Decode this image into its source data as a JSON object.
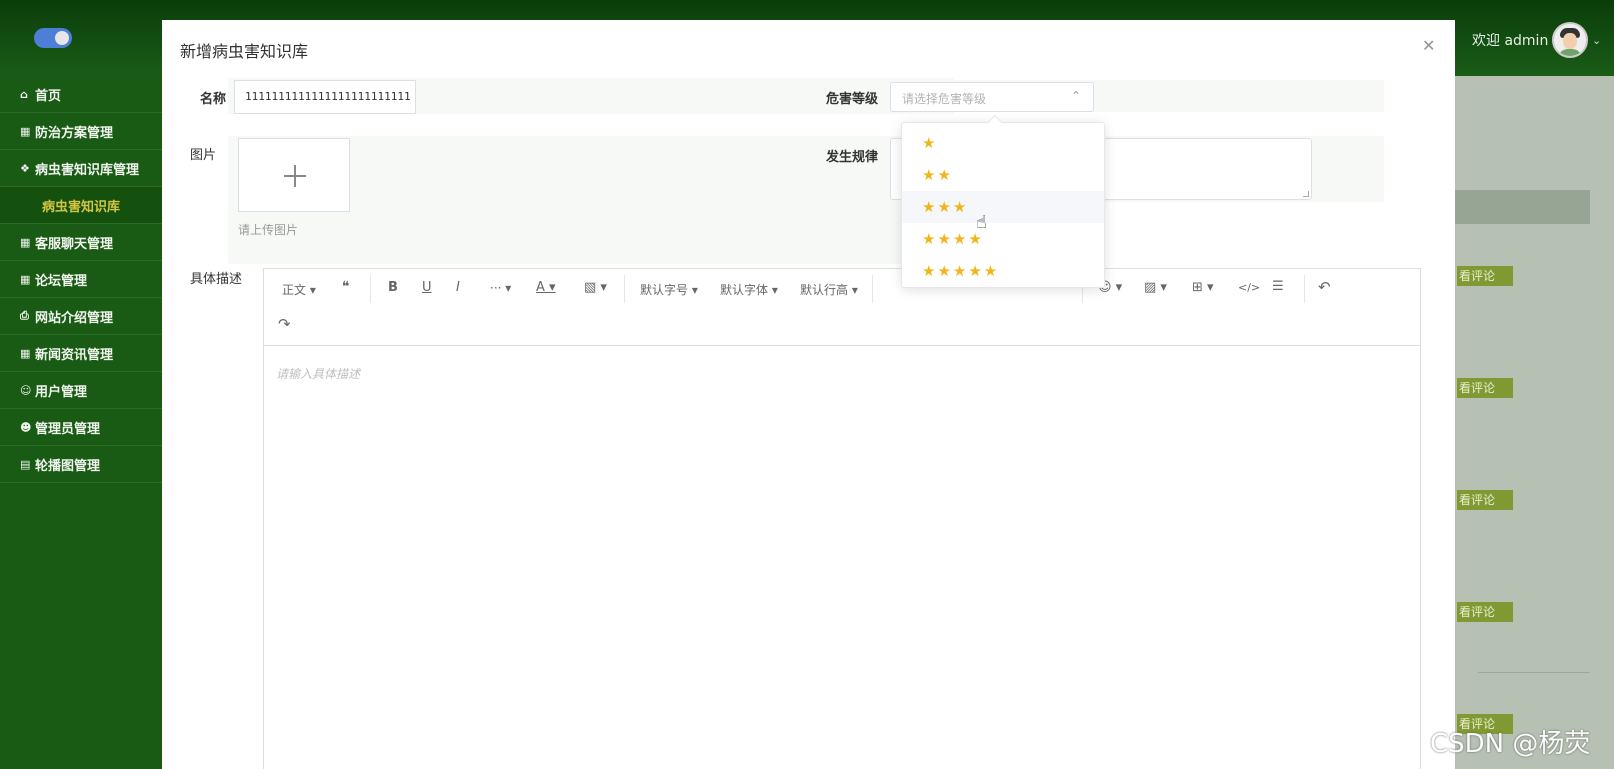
{
  "header": {
    "welcome": "欢迎 admin"
  },
  "sidebar": {
    "items": [
      {
        "icon": "home-icon",
        "glyph": "⌂",
        "label": "首页"
      },
      {
        "icon": "list-icon",
        "glyph": "▦",
        "label": "防治方案管理"
      },
      {
        "icon": "grid-icon",
        "glyph": "❖",
        "label": "病虫害知识库管理"
      },
      {
        "icon": "",
        "glyph": "",
        "label": "病虫害知识库",
        "sub": true
      },
      {
        "icon": "list-icon",
        "glyph": "▦",
        "label": "客服聊天管理"
      },
      {
        "icon": "list-icon",
        "glyph": "▦",
        "label": "论坛管理"
      },
      {
        "icon": "printer-icon",
        "glyph": "⎙",
        "label": "网站介绍管理"
      },
      {
        "icon": "list-icon",
        "glyph": "▦",
        "label": "新闻资讯管理"
      },
      {
        "icon": "user-icon",
        "glyph": "☺",
        "label": "用户管理"
      },
      {
        "icon": "admin-icon",
        "glyph": "☻",
        "label": "管理员管理"
      },
      {
        "icon": "image-icon",
        "glyph": "▤",
        "label": "轮播图管理"
      }
    ]
  },
  "background": {
    "view_comments": "看评论"
  },
  "modal": {
    "title": "新增病虫害知识库",
    "name_label": "名称",
    "name_value": "1111111111111111111111111",
    "level_label": "危害等级",
    "level_placeholder": "请选择危害等级",
    "image_label": "图片",
    "upload_hint": "请上传图片",
    "pattern_label": "发生规律",
    "desc_label": "具体描述",
    "desc_placeholder": "请输入具体描述"
  },
  "editor_toolbar": {
    "heading": "正文",
    "font_size": "默认字号",
    "font_family": "默认字体",
    "line_height": "默认行高"
  },
  "dropdown": {
    "options": [
      "★",
      "★★",
      "★★★",
      "★★★★",
      "★★★★★"
    ],
    "hovered_index": 2,
    "star_color": "#f2b51c"
  },
  "watermark": "CSDN @杨荧"
}
